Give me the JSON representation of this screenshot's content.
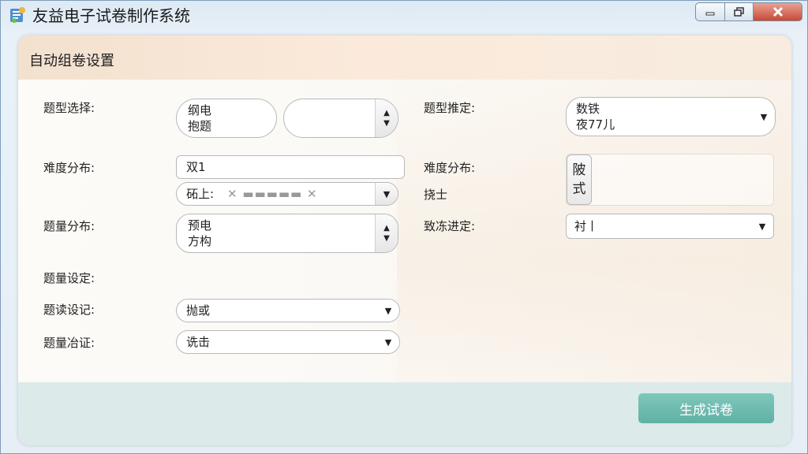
{
  "window": {
    "title": "友益电子试卷制作系统",
    "controls": {
      "minimize": "▭",
      "maximize": "❐",
      "close": "✕"
    }
  },
  "panel": {
    "title": "自动组卷设置"
  },
  "form": {
    "left": [
      {
        "label": "题型选择:",
        "field1_line1": "纲电",
        "field1_line2": "抱题",
        "field2_value": ""
      },
      {
        "label": "难度分布:",
        "top_value": "双1",
        "bottom_value": "砳上:",
        "marks": "✕  ▬▬▬▬▬  ✕"
      },
      {
        "label": "题量分布:",
        "line1": "预电",
        "line2": "方构"
      },
      {
        "label": "题量设定:"
      },
      {
        "label": "题读设记:",
        "value": "抛或"
      },
      {
        "label": "题量冶证:",
        "value": "诜击"
      }
    ],
    "right": [
      {
        "label": "题型推定:",
        "line1": "数铁",
        "line2": "夜77儿"
      },
      {
        "label": "难度分布:",
        "sub_label": "挠士",
        "button_line1": "陂",
        "button_line2": "式"
      },
      {
        "label": "致冻进定:",
        "value": "衬丨"
      }
    ]
  },
  "icons": {
    "dropdown": "▼",
    "spin_up": "▲",
    "spin_down": "▼",
    "app": "app-logo-icon"
  },
  "colors": {
    "accent": "#66b8ab",
    "header": "#f6e4d2",
    "footer": "#dceaea"
  },
  "actions": {
    "generate_label": "生成试卷"
  }
}
